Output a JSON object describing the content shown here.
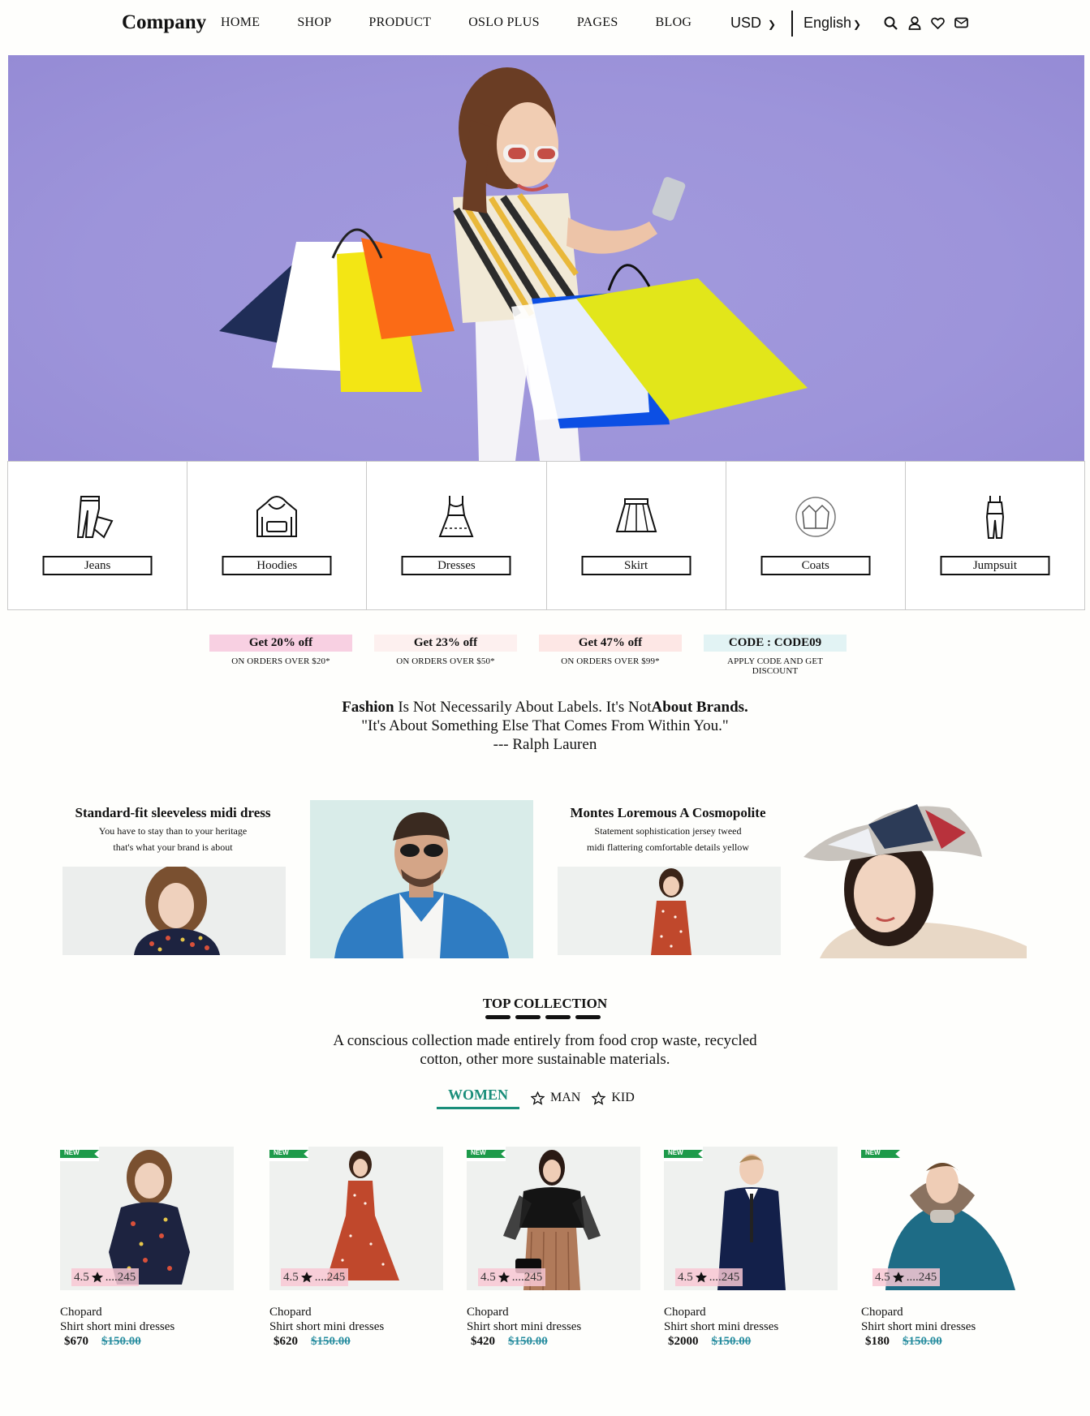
{
  "nav": {
    "brand": "Company",
    "links": [
      "HOME",
      "SHOP",
      "PRODUCT",
      "OSLO PLUS",
      "PAGES",
      "BLOG"
    ],
    "currency": "USD",
    "language": "English",
    "icons": [
      "search-icon",
      "user-icon",
      "heart-icon",
      "mail-icon"
    ]
  },
  "categories": [
    {
      "label": "Jeans",
      "icon": "jeans-icon"
    },
    {
      "label": "Hoodies",
      "icon": "hoodie-icon"
    },
    {
      "label": "Dresses",
      "icon": "dress-icon"
    },
    {
      "label": "Skirt",
      "icon": "skirt-icon"
    },
    {
      "label": "Coats",
      "icon": "coat-icon"
    },
    {
      "label": "Jumpsuit",
      "icon": "jumpsuit-icon"
    }
  ],
  "offers": [
    {
      "title": "Get 20% off",
      "sub": "ON ORDERS OVER $20*",
      "color": "#f8d0e2"
    },
    {
      "title": "Get 23% off",
      "sub": "ON ORDERS OVER $50*",
      "color": "#fdf0ef"
    },
    {
      "title": "Get 47% off",
      "sub": "ON ORDERS OVER $99*",
      "color": "#fde7e5"
    },
    {
      "title": "CODE : CODE09",
      "sub": "APPLY CODE AND GET DISCOUNT",
      "color": "#e2f3f4"
    }
  ],
  "quote": {
    "word1": "Fashion",
    "part1": " Is Not Necessarily About Labels. It's Not",
    "word2": "About Brands.",
    "line2": "\"It's About Something Else That Comes From Within You.\"",
    "line3": "--- Ralph Lauren"
  },
  "promos": [
    {
      "title": "Standard-fit sleeveless midi dress",
      "desc1": "You have to stay than to your heritage",
      "desc2": "that's what your brand is about"
    },
    {
      "title": "Montes Loremous A Cosmopolite",
      "desc1": "Statement sophistication jersey tweed",
      "desc2": "midi flattering comfortable details yellow"
    }
  ],
  "collection": {
    "title": "TOP COLLECTION",
    "desc1": "A conscious collection made entirely from food crop waste, recycled",
    "desc2": "cotton, other more sustainable materials.",
    "tabs": [
      "WOMEN",
      "MAN",
      "KID"
    ]
  },
  "products": [
    {
      "tag": "NEW",
      "rating": "4.5",
      "reviews": "....245",
      "brand": "Chopard",
      "name": "Shirt short mini dresses",
      "price": "$670",
      "old_price": "$150.00"
    },
    {
      "tag": "NEW",
      "rating": "4.5",
      "reviews": "....245",
      "brand": "Chopard",
      "name": "Shirt short mini dresses",
      "price": "$620",
      "old_price": "$150.00"
    },
    {
      "tag": "NEW",
      "rating": "4.5",
      "reviews": "....245",
      "brand": "Chopard",
      "name": "Shirt short mini dresses",
      "price": "$420",
      "old_price": "$150.00"
    },
    {
      "tag": "NEW",
      "rating": "4.5",
      "reviews": "....245",
      "brand": "Chopard",
      "name": "Shirt short mini dresses",
      "price": "$2000",
      "old_price": "$150.00"
    },
    {
      "tag": "NEW",
      "rating": "4.5",
      "reviews": "....245",
      "brand": "Chopard",
      "name": "Shirt short mini dresses",
      "price": "$180",
      "old_price": "$150.00"
    }
  ],
  "colors": {
    "accent": "#1a8e7a",
    "old_price": "#2a8ea0",
    "hero_bg": "#9d94da"
  }
}
